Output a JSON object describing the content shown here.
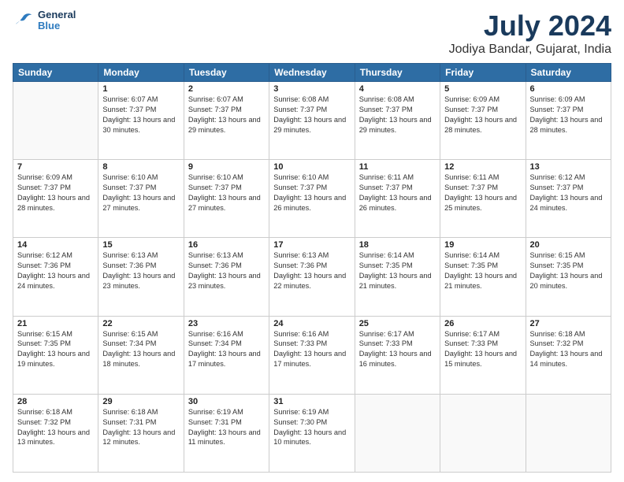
{
  "logo": {
    "line1": "General",
    "line2": "Blue"
  },
  "title": "July 2024",
  "subtitle": "Jodiya Bandar, Gujarat, India",
  "headers": [
    "Sunday",
    "Monday",
    "Tuesday",
    "Wednesday",
    "Thursday",
    "Friday",
    "Saturday"
  ],
  "weeks": [
    [
      {
        "day": "",
        "sunrise": "",
        "sunset": "",
        "daylight": ""
      },
      {
        "day": "1",
        "sunrise": "Sunrise: 6:07 AM",
        "sunset": "Sunset: 7:37 PM",
        "daylight": "Daylight: 13 hours and 30 minutes."
      },
      {
        "day": "2",
        "sunrise": "Sunrise: 6:07 AM",
        "sunset": "Sunset: 7:37 PM",
        "daylight": "Daylight: 13 hours and 29 minutes."
      },
      {
        "day": "3",
        "sunrise": "Sunrise: 6:08 AM",
        "sunset": "Sunset: 7:37 PM",
        "daylight": "Daylight: 13 hours and 29 minutes."
      },
      {
        "day": "4",
        "sunrise": "Sunrise: 6:08 AM",
        "sunset": "Sunset: 7:37 PM",
        "daylight": "Daylight: 13 hours and 29 minutes."
      },
      {
        "day": "5",
        "sunrise": "Sunrise: 6:09 AM",
        "sunset": "Sunset: 7:37 PM",
        "daylight": "Daylight: 13 hours and 28 minutes."
      },
      {
        "day": "6",
        "sunrise": "Sunrise: 6:09 AM",
        "sunset": "Sunset: 7:37 PM",
        "daylight": "Daylight: 13 hours and 28 minutes."
      }
    ],
    [
      {
        "day": "7",
        "sunrise": "Sunrise: 6:09 AM",
        "sunset": "Sunset: 7:37 PM",
        "daylight": "Daylight: 13 hours and 28 minutes."
      },
      {
        "day": "8",
        "sunrise": "Sunrise: 6:10 AM",
        "sunset": "Sunset: 7:37 PM",
        "daylight": "Daylight: 13 hours and 27 minutes."
      },
      {
        "day": "9",
        "sunrise": "Sunrise: 6:10 AM",
        "sunset": "Sunset: 7:37 PM",
        "daylight": "Daylight: 13 hours and 27 minutes."
      },
      {
        "day": "10",
        "sunrise": "Sunrise: 6:10 AM",
        "sunset": "Sunset: 7:37 PM",
        "daylight": "Daylight: 13 hours and 26 minutes."
      },
      {
        "day": "11",
        "sunrise": "Sunrise: 6:11 AM",
        "sunset": "Sunset: 7:37 PM",
        "daylight": "Daylight: 13 hours and 26 minutes."
      },
      {
        "day": "12",
        "sunrise": "Sunrise: 6:11 AM",
        "sunset": "Sunset: 7:37 PM",
        "daylight": "Daylight: 13 hours and 25 minutes."
      },
      {
        "day": "13",
        "sunrise": "Sunrise: 6:12 AM",
        "sunset": "Sunset: 7:37 PM",
        "daylight": "Daylight: 13 hours and 24 minutes."
      }
    ],
    [
      {
        "day": "14",
        "sunrise": "Sunrise: 6:12 AM",
        "sunset": "Sunset: 7:36 PM",
        "daylight": "Daylight: 13 hours and 24 minutes."
      },
      {
        "day": "15",
        "sunrise": "Sunrise: 6:13 AM",
        "sunset": "Sunset: 7:36 PM",
        "daylight": "Daylight: 13 hours and 23 minutes."
      },
      {
        "day": "16",
        "sunrise": "Sunrise: 6:13 AM",
        "sunset": "Sunset: 7:36 PM",
        "daylight": "Daylight: 13 hours and 23 minutes."
      },
      {
        "day": "17",
        "sunrise": "Sunrise: 6:13 AM",
        "sunset": "Sunset: 7:36 PM",
        "daylight": "Daylight: 13 hours and 22 minutes."
      },
      {
        "day": "18",
        "sunrise": "Sunrise: 6:14 AM",
        "sunset": "Sunset: 7:35 PM",
        "daylight": "Daylight: 13 hours and 21 minutes."
      },
      {
        "day": "19",
        "sunrise": "Sunrise: 6:14 AM",
        "sunset": "Sunset: 7:35 PM",
        "daylight": "Daylight: 13 hours and 21 minutes."
      },
      {
        "day": "20",
        "sunrise": "Sunrise: 6:15 AM",
        "sunset": "Sunset: 7:35 PM",
        "daylight": "Daylight: 13 hours and 20 minutes."
      }
    ],
    [
      {
        "day": "21",
        "sunrise": "Sunrise: 6:15 AM",
        "sunset": "Sunset: 7:35 PM",
        "daylight": "Daylight: 13 hours and 19 minutes."
      },
      {
        "day": "22",
        "sunrise": "Sunrise: 6:15 AM",
        "sunset": "Sunset: 7:34 PM",
        "daylight": "Daylight: 13 hours and 18 minutes."
      },
      {
        "day": "23",
        "sunrise": "Sunrise: 6:16 AM",
        "sunset": "Sunset: 7:34 PM",
        "daylight": "Daylight: 13 hours and 17 minutes."
      },
      {
        "day": "24",
        "sunrise": "Sunrise: 6:16 AM",
        "sunset": "Sunset: 7:33 PM",
        "daylight": "Daylight: 13 hours and 17 minutes."
      },
      {
        "day": "25",
        "sunrise": "Sunrise: 6:17 AM",
        "sunset": "Sunset: 7:33 PM",
        "daylight": "Daylight: 13 hours and 16 minutes."
      },
      {
        "day": "26",
        "sunrise": "Sunrise: 6:17 AM",
        "sunset": "Sunset: 7:33 PM",
        "daylight": "Daylight: 13 hours and 15 minutes."
      },
      {
        "day": "27",
        "sunrise": "Sunrise: 6:18 AM",
        "sunset": "Sunset: 7:32 PM",
        "daylight": "Daylight: 13 hours and 14 minutes."
      }
    ],
    [
      {
        "day": "28",
        "sunrise": "Sunrise: 6:18 AM",
        "sunset": "Sunset: 7:32 PM",
        "daylight": "Daylight: 13 hours and 13 minutes."
      },
      {
        "day": "29",
        "sunrise": "Sunrise: 6:18 AM",
        "sunset": "Sunset: 7:31 PM",
        "daylight": "Daylight: 13 hours and 12 minutes."
      },
      {
        "day": "30",
        "sunrise": "Sunrise: 6:19 AM",
        "sunset": "Sunset: 7:31 PM",
        "daylight": "Daylight: 13 hours and 11 minutes."
      },
      {
        "day": "31",
        "sunrise": "Sunrise: 6:19 AM",
        "sunset": "Sunset: 7:30 PM",
        "daylight": "Daylight: 13 hours and 10 minutes."
      },
      {
        "day": "",
        "sunrise": "",
        "sunset": "",
        "daylight": ""
      },
      {
        "day": "",
        "sunrise": "",
        "sunset": "",
        "daylight": ""
      },
      {
        "day": "",
        "sunrise": "",
        "sunset": "",
        "daylight": ""
      }
    ]
  ]
}
